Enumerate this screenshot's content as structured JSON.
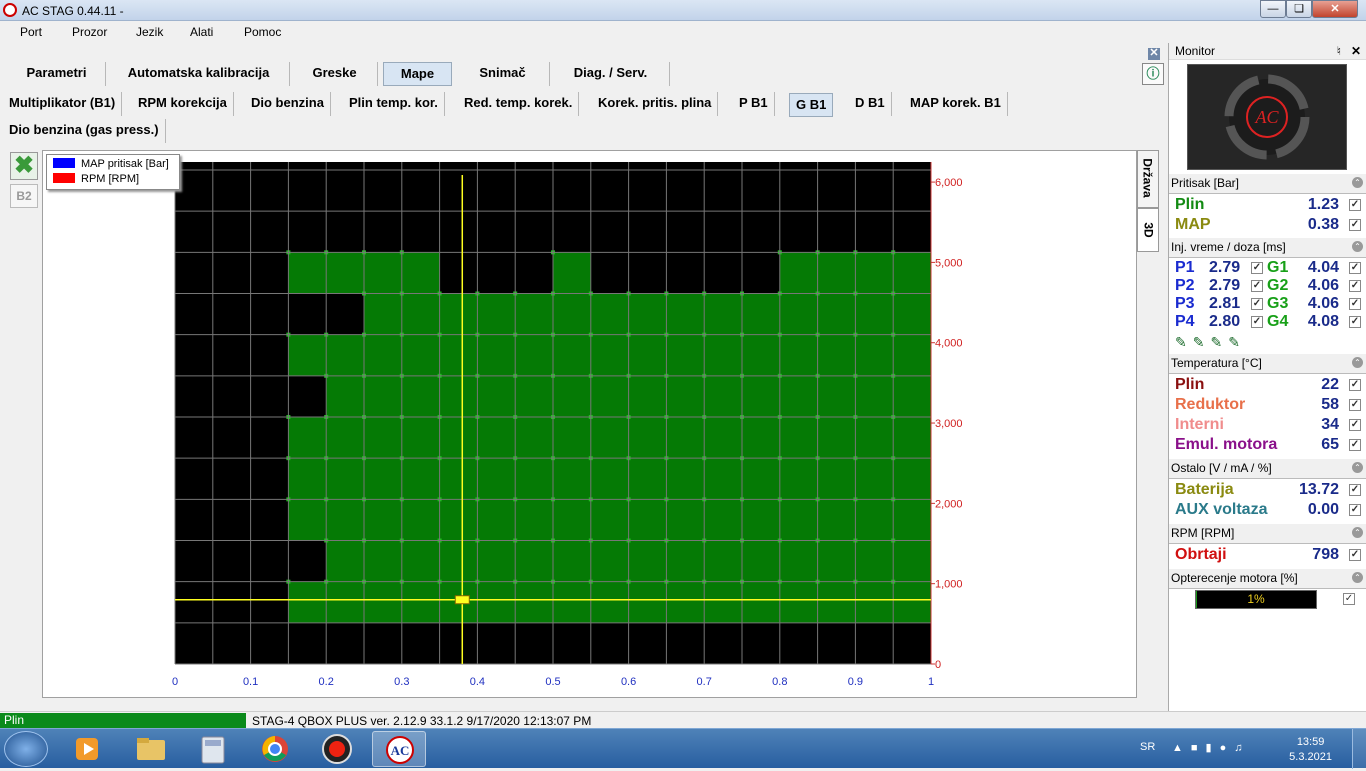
{
  "window": {
    "title": "AC STAG 0.44.11 -"
  },
  "menu": [
    "Port",
    "Prozor",
    "Jezik",
    "Alati",
    "Pomoc"
  ],
  "tabs": [
    {
      "label": "Parametri"
    },
    {
      "label": "Automatska kalibracija"
    },
    {
      "label": "Greske"
    },
    {
      "label": "Mape",
      "selected": true
    },
    {
      "label": "Snimač"
    },
    {
      "label": "Diag. / Serv."
    }
  ],
  "subtabs": [
    {
      "label": "Multiplikator (B1)"
    },
    {
      "label": "RPM korekcija"
    },
    {
      "label": "Dio benzina"
    },
    {
      "label": "Plin temp. kor."
    },
    {
      "label": "Red. temp. korek."
    },
    {
      "label": "Korek. pritis. plina"
    },
    {
      "label": "P B1"
    },
    {
      "label": "G B1",
      "selected": true
    },
    {
      "label": "D B1"
    },
    {
      "label": "MAP korek. B1"
    }
  ],
  "subtab_row2": "Dio benzina (gas press.)",
  "side_buttons": {
    "b2": "B2"
  },
  "vertical_tabs": {
    "drzava": "Država",
    "td": "3D"
  },
  "legend": [
    {
      "label": "MAP pritisak [Bar]",
      "color": "#0000ff"
    },
    {
      "label": "RPM [RPM]",
      "color": "#ff0000"
    }
  ],
  "chart_data": {
    "type": "heatmap",
    "x_ticks": [
      "0",
      "0.1",
      "0.2",
      "0.3",
      "0.4",
      "0.5",
      "0.6",
      "0.7",
      "0.8",
      "0.9",
      "1"
    ],
    "y_ticks_right": [
      "0",
      "1,000",
      "2,000",
      "3,000",
      "4,000",
      "5,000",
      "6,000"
    ],
    "xlim": [
      0,
      1
    ],
    "ylim": [
      0,
      6250
    ],
    "columns": 20,
    "rows": 12,
    "cell_colors": {
      "active": "#057a05",
      "inactive": "#000000"
    },
    "active_cells_by_row_from_top": [
      [],
      [],
      [
        3,
        4,
        5,
        6,
        10,
        16,
        17,
        18,
        19
      ],
      [
        5,
        6,
        7,
        8,
        9,
        10,
        11,
        12,
        13,
        14,
        15,
        16,
        17,
        18,
        19
      ],
      [
        3,
        4,
        5,
        6,
        7,
        8,
        9,
        10,
        11,
        12,
        13,
        14,
        15,
        16,
        17,
        18,
        19
      ],
      [
        4,
        5,
        6,
        7,
        8,
        9,
        10,
        11,
        12,
        13,
        14,
        15,
        16,
        17,
        18,
        19
      ],
      [
        3,
        4,
        5,
        6,
        7,
        8,
        9,
        10,
        11,
        12,
        13,
        14,
        15,
        16,
        17,
        18,
        19
      ],
      [
        3,
        4,
        5,
        6,
        7,
        8,
        9,
        10,
        11,
        12,
        13,
        14,
        15,
        16,
        17,
        18,
        19
      ],
      [
        3,
        4,
        5,
        6,
        7,
        8,
        9,
        10,
        11,
        12,
        13,
        14,
        15,
        16,
        17,
        18,
        19
      ],
      [
        4,
        5,
        6,
        7,
        8,
        9,
        10,
        11,
        12,
        13,
        14,
        15,
        16,
        17,
        18,
        19
      ],
      [
        3,
        4,
        5,
        6,
        7,
        8,
        9,
        10,
        11,
        12,
        13,
        14,
        15,
        16,
        17,
        18,
        19
      ],
      []
    ],
    "cursor": {
      "x": 0.38,
      "y": 800
    },
    "grid": true
  },
  "status": {
    "left": "Plin",
    "right": "STAG-4 QBOX PLUS  ver. 2.12.9  33.1.2  9/17/2020 12:13:07 PM"
  },
  "monitor": {
    "title": "Monitor",
    "pressure": {
      "header": "Pritisak [Bar]",
      "rows": [
        {
          "label": "Plin",
          "value": "1.23",
          "color": "#128a12"
        },
        {
          "label": "MAP",
          "value": "0.38",
          "color": "#8a8a10"
        }
      ]
    },
    "injection": {
      "header": "Inj. vreme / doza [ms]",
      "rows": [
        {
          "p": "P1",
          "pv": "2.79",
          "g": "G1",
          "gv": "4.04"
        },
        {
          "p": "P2",
          "pv": "2.79",
          "g": "G2",
          "gv": "4.06"
        },
        {
          "p": "P3",
          "pv": "2.81",
          "g": "G3",
          "gv": "4.06"
        },
        {
          "p": "P4",
          "pv": "2.80",
          "g": "G4",
          "gv": "4.08"
        }
      ]
    },
    "temperature": {
      "header": "Temperatura [°C]",
      "rows": [
        {
          "label": "Plin",
          "value": "22",
          "color": "#8a1010"
        },
        {
          "label": "Reduktor",
          "value": "58",
          "color": "#e8704a"
        },
        {
          "label": "Interni",
          "value": "34",
          "color": "#f08c8c"
        },
        {
          "label": "Emul. motora",
          "value": "65",
          "color": "#8a108a"
        }
      ]
    },
    "other": {
      "header": "Ostalo [V / mA / %]",
      "rows": [
        {
          "label": "Baterija",
          "value": "13.72",
          "color": "#8a8a10"
        },
        {
          "label": "AUX voltaza",
          "value": "0.00",
          "color": "#2a7a8a"
        }
      ]
    },
    "rpm": {
      "header": "RPM [RPM]",
      "rows": [
        {
          "label": "Obrtaji",
          "value": "798",
          "color": "#d01010"
        }
      ]
    },
    "load": {
      "header": "Opterecenje motora [%]",
      "value": "1%",
      "fraction": 0.01
    }
  },
  "taskbar": {
    "lang": "SR",
    "time": "13:59",
    "date": "5.3.2021"
  }
}
